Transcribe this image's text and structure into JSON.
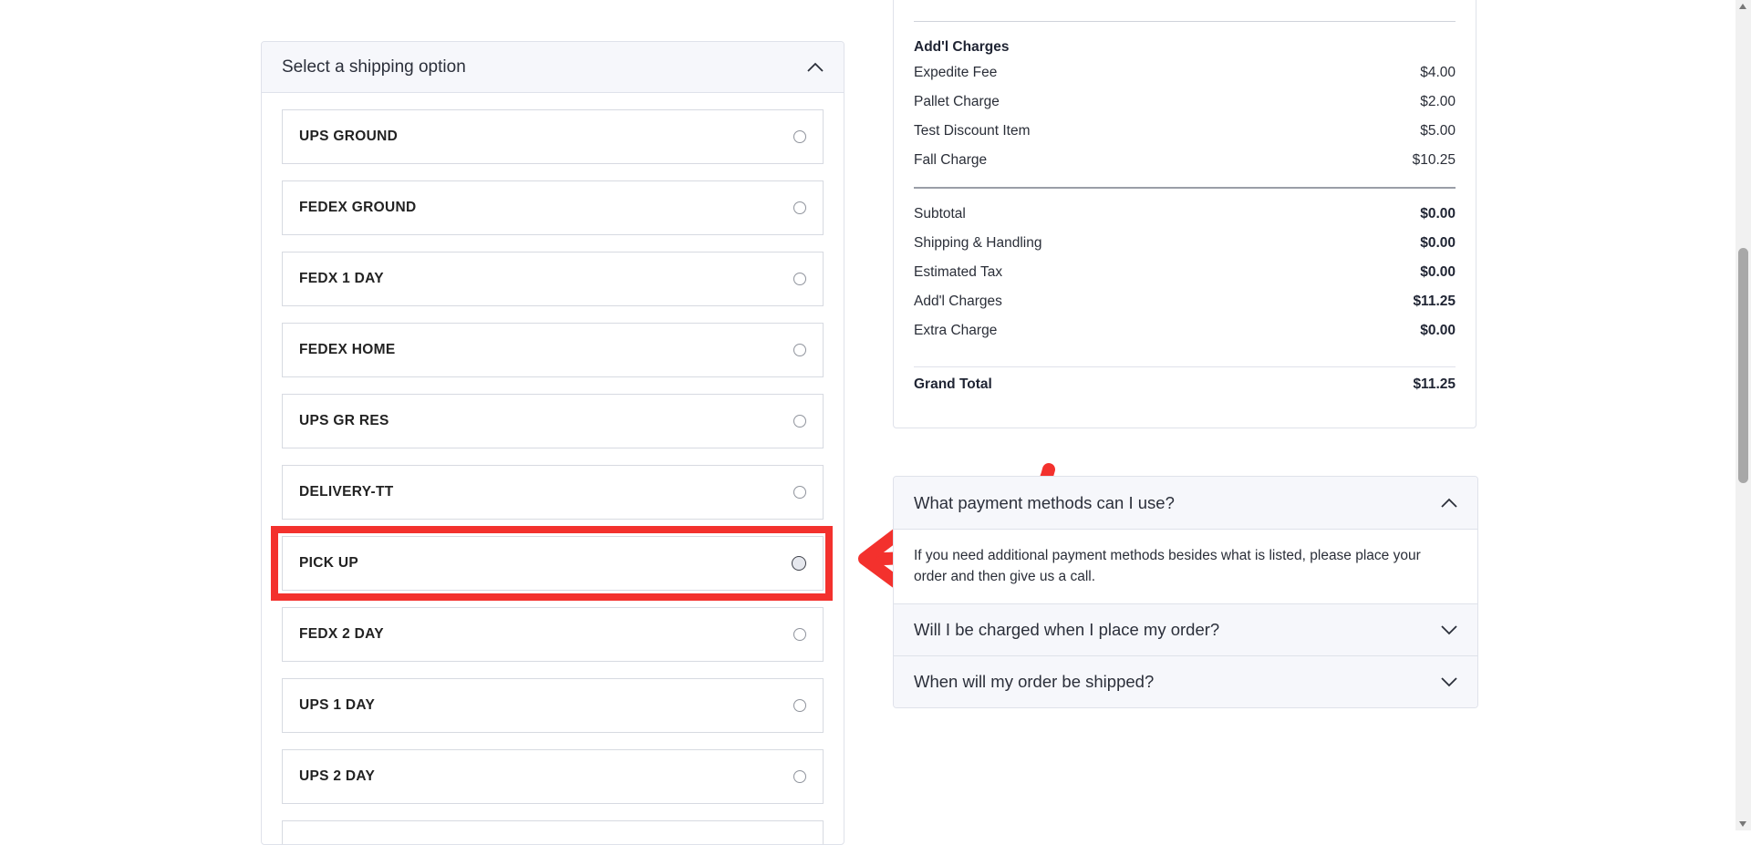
{
  "shipping": {
    "header_title": "Select a shipping option",
    "options": [
      {
        "label": "UPS GROUND"
      },
      {
        "label": "FEDEX GROUND"
      },
      {
        "label": "FEDX 1 DAY"
      },
      {
        "label": "FEDEX HOME"
      },
      {
        "label": "UPS GR RES"
      },
      {
        "label": "DELIVERY-TT"
      },
      {
        "label": "PICK UP"
      },
      {
        "label": "FEDX 2 DAY"
      },
      {
        "label": "UPS 1 DAY"
      },
      {
        "label": "UPS 2 DAY"
      }
    ]
  },
  "summary": {
    "addl_title": "Add'l Charges",
    "addl_items": [
      {
        "label": "Expedite Fee",
        "value": "$4.00"
      },
      {
        "label": "Pallet Charge",
        "value": "$2.00"
      },
      {
        "label": "Test Discount Item",
        "value": "$5.00"
      },
      {
        "label": "Fall Charge",
        "value": "$10.25"
      }
    ],
    "totals": [
      {
        "label": "Subtotal",
        "value": "$0.00"
      },
      {
        "label": "Shipping & Handling",
        "value": "$0.00"
      },
      {
        "label": "Estimated Tax",
        "value": "$0.00"
      },
      {
        "label": "Add'l Charges",
        "value": "$11.25"
      },
      {
        "label": "Extra Charge",
        "value": "$0.00"
      }
    ],
    "grand_total_label": "Grand Total",
    "grand_total_value": "$11.25"
  },
  "faq": {
    "items": [
      {
        "question": "What payment methods can I use?",
        "answer": "If you need additional payment methods besides what is listed, please place your order and then give us a call."
      },
      {
        "question": "Will I be charged when I place my order?"
      },
      {
        "question": "When will my order be shipped?"
      }
    ]
  },
  "annotation_color": "#f3312d"
}
